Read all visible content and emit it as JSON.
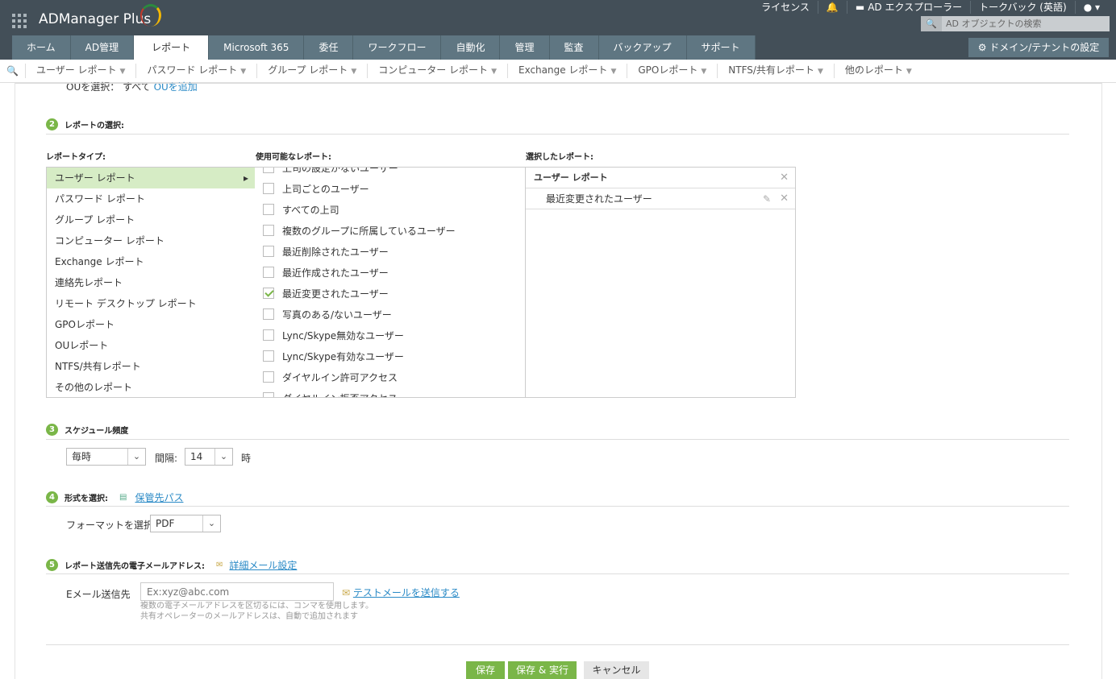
{
  "header": {
    "app_name": "ADManager Plus",
    "top_links": [
      "ライセンス",
      "AD エクスプローラー",
      "トークバック (英語)"
    ],
    "search_placeholder": "AD オブジェクトの検索",
    "domain_button": "ドメイン/テナントの設定"
  },
  "tabs": [
    "ホーム",
    "AD管理",
    "レポート",
    "Microsoft 365",
    "委任",
    "ワークフロー",
    "自動化",
    "管理",
    "監査",
    "バックアップ",
    "サポート"
  ],
  "subnav": [
    "ユーザー レポート",
    "パスワード レポート",
    "グループ レポート",
    "コンピューター レポート",
    "Exchange レポート",
    "GPOレポート",
    "NTFS/共有レポート",
    "他のレポート"
  ],
  "ou": {
    "label": "OUを選択：",
    "value": "すべて",
    "add_link": "OUを追加"
  },
  "step2": {
    "num": "2",
    "title": "レポートの選択:",
    "type_header": "レポートタイプ:",
    "avail_header": "使用可能なレポート:",
    "selected_header": "選択したレポート:",
    "types": [
      "ユーザー レポート",
      "パスワード レポート",
      "グループ レポート",
      "コンピューター レポート",
      "Exchange レポート",
      "連絡先レポート",
      "リモート デスクトップ レポート",
      "GPOレポート",
      "OUレポート",
      "NTFS/共有レポート",
      "その他のレポート"
    ],
    "available": [
      {
        "label": "上司の設定がないユーザー",
        "checked": false
      },
      {
        "label": "上司ごとのユーザー",
        "checked": false
      },
      {
        "label": "すべての上司",
        "checked": false
      },
      {
        "label": "複数のグループに所属しているユーザー",
        "checked": false
      },
      {
        "label": "最近削除されたユーザー",
        "checked": false
      },
      {
        "label": "最近作成されたユーザー",
        "checked": false
      },
      {
        "label": "最近変更されたユーザー",
        "checked": true
      },
      {
        "label": "写真のある/ないユーザー",
        "checked": false
      },
      {
        "label": "Lync/Skype無効なユーザー",
        "checked": false
      },
      {
        "label": "Lync/Skype有効なユーザー",
        "checked": false
      },
      {
        "label": "ダイヤルイン許可アクセス",
        "checked": false
      },
      {
        "label": "ダイヤルイン拒否アクセス",
        "checked": false
      }
    ],
    "selected_group": "ユーザー レポート",
    "selected_items": [
      "最近変更されたユーザー"
    ]
  },
  "step3": {
    "num": "3",
    "title": "スケジュール頻度",
    "frequency": "毎時",
    "interval_label": "間隔:",
    "interval": "14",
    "unit": "時"
  },
  "step4": {
    "num": "4",
    "title": "形式を選択:",
    "path_link": "保管先パス",
    "format_label": "フォーマットを選択",
    "format": "PDF"
  },
  "step5": {
    "num": "5",
    "title": "レポート送信先の電子メールアドレス:",
    "advanced_link": "詳細メール設定",
    "email_label": "Eメール送信先",
    "email_placeholder": "Ex:xyz@abc.com",
    "test_link": "テストメールを送信する",
    "hint1": "複数の電子メールアドレスを区切るには、コンマを使用します。",
    "hint2": "共有オペレーターのメールアドレスは、自動で追加されます"
  },
  "actions": {
    "save": "保存",
    "save_run": "保存 & 実行",
    "cancel": "キャンセル"
  }
}
